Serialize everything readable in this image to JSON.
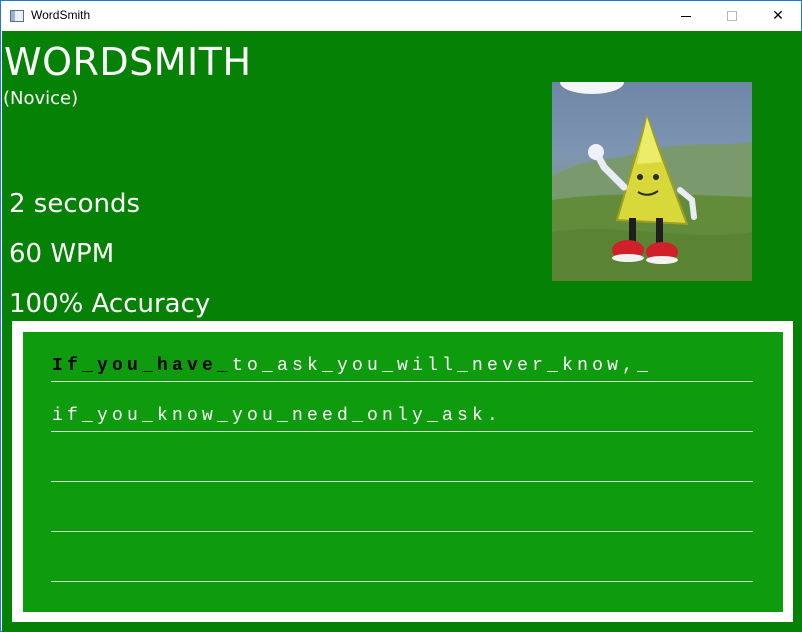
{
  "window": {
    "title": "WordSmith",
    "icon": "app-window-icon",
    "controls": {
      "minimize_icon": "minimize-icon",
      "maximize_icon": "maximize-icon",
      "close_glyph": "✕"
    }
  },
  "header": {
    "app_name": "WORDSMITH",
    "rank": "(Novice)"
  },
  "stats": {
    "time": "2 seconds",
    "wpm": "60 WPM",
    "accuracy": "100% Accuracy"
  },
  "portrait": {
    "icon": "mascot-character-image"
  },
  "typing": {
    "line1_typed": "If_you_have_",
    "line1_rest": "to_ask_you_will_never_know,_",
    "line2": "if_you_know_you_need_only_ask."
  },
  "colors": {
    "background": "#058205",
    "panel": "#0e9c0e",
    "panel_border": "#ffffff",
    "typed_text": "#000000",
    "untyped_text": "#ffffff"
  }
}
